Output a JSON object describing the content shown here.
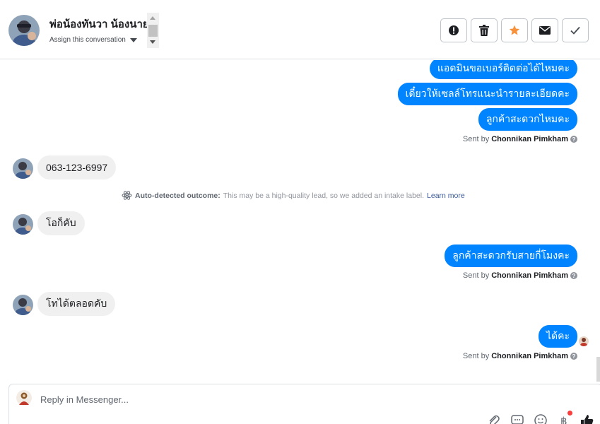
{
  "header": {
    "contact_name": "พ่อน้องทันวา น้องนาย",
    "assign_label": "Assign this conversation",
    "actions": [
      {
        "name": "mark-spam-button",
        "icon": "exclamation-circle-icon"
      },
      {
        "name": "delete-button",
        "icon": "trash-icon"
      },
      {
        "name": "star-button",
        "icon": "star-icon",
        "color": "#f7923b"
      },
      {
        "name": "mark-unread-button",
        "icon": "envelope-icon"
      },
      {
        "name": "mark-done-button",
        "icon": "checkmark-icon"
      }
    ]
  },
  "conversation": {
    "outgoing_1": "แอดมินขอเบอร์ติดต่อได้ไหมคะ",
    "outgoing_2": "เดี๋ยวให้เซลล์โทรแนะนำรายละเอียดคะ",
    "outgoing_3": "ลูกค้าสะดวกไหมคะ",
    "sent_by_prefix": "Sent by",
    "sent_by_name": "Chonnikan Pimkham",
    "incoming_1": "063-123-6997",
    "auto_title": "Auto-detected outcome:",
    "auto_text": "This may be a high-quality lead, so we added an intake label.",
    "learn_more": "Learn more",
    "incoming_2": "โอก็คับ",
    "outgoing_4": "ลูกค้าสะดวกรับสายกี่โมงคะ",
    "incoming_3": "โทได้ตลอดคับ",
    "outgoing_5": "ได้คะ"
  },
  "composer": {
    "placeholder": "Reply in Messenger...",
    "tools": [
      "paperclip-icon",
      "saved-replies-icon",
      "emoji-icon",
      "payment-icon",
      "thumbs-up-icon"
    ]
  },
  "colors": {
    "outgoing_bubble": "#0084ff",
    "incoming_bubble": "#f1f0f0",
    "link": "#385898",
    "notification_dot": "#fa3e3e"
  }
}
